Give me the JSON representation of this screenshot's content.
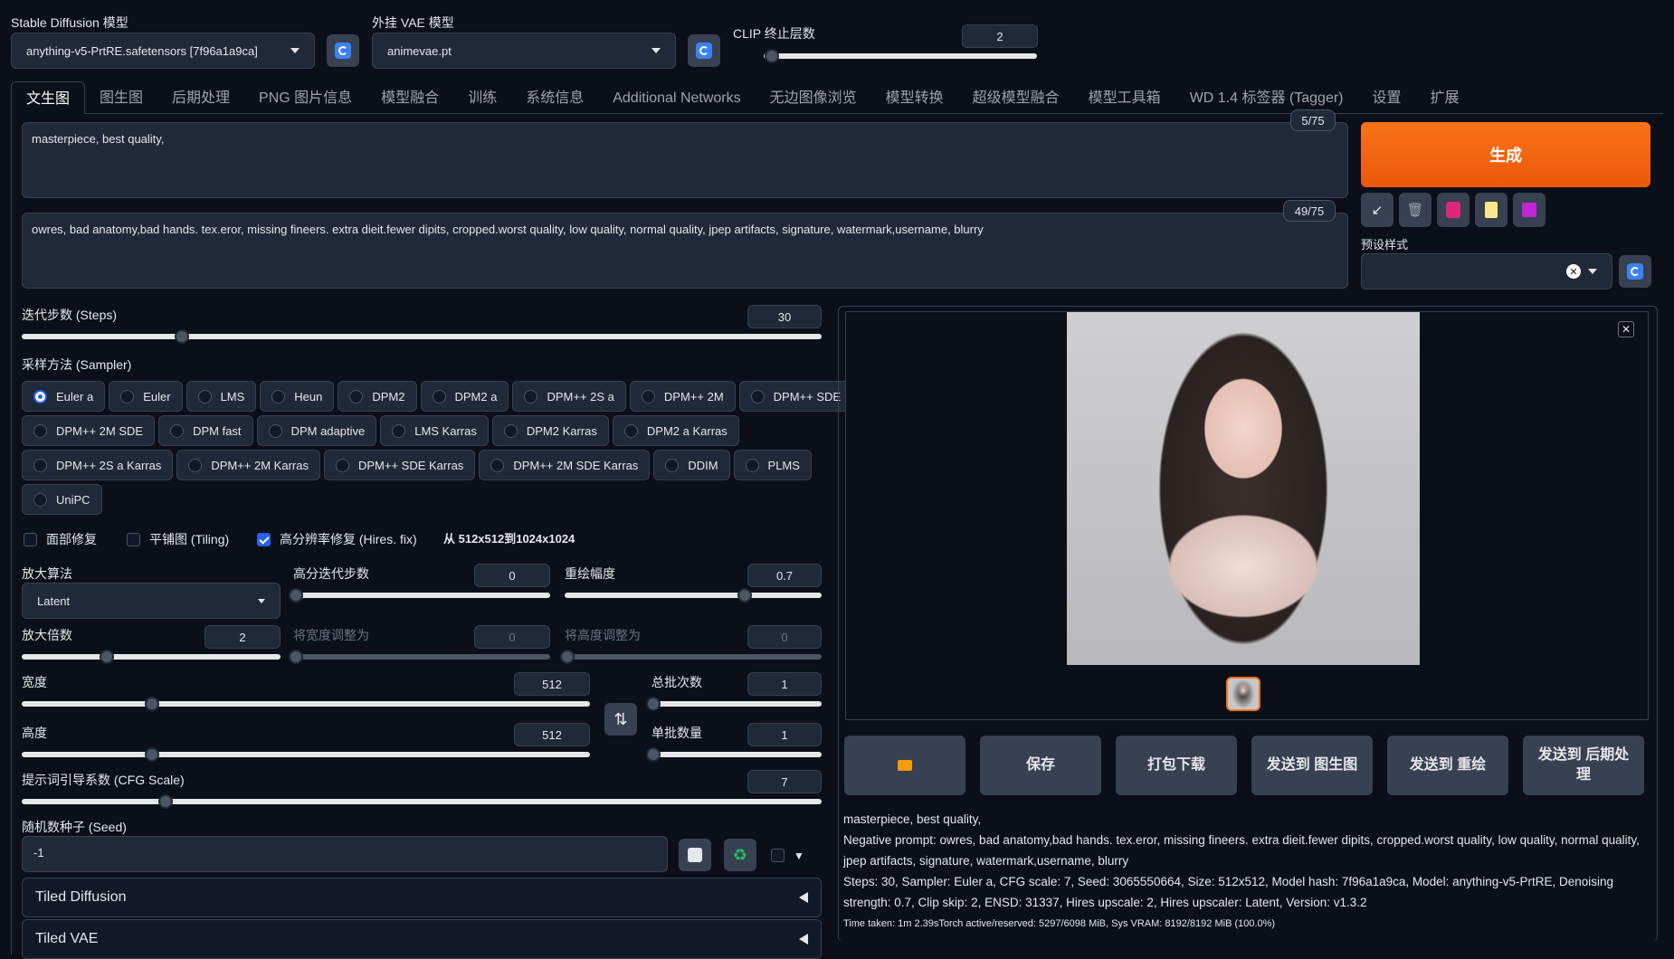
{
  "models": {
    "sd_label": "Stable Diffusion 模型",
    "sd_value": "anything-v5-PrtRE.safetensors [7f96a1a9ca]",
    "vae_label": "外挂 VAE 模型",
    "vae_value": "animevae.pt",
    "clip_label": "CLIP 终止层数",
    "clip_value": "2",
    "clip_fraction": 0.0
  },
  "tabs": [
    "文生图",
    "图生图",
    "后期处理",
    "PNG 图片信息",
    "模型融合",
    "训练",
    "系统信息",
    "Additional Networks",
    "无边图像浏览",
    "模型转换",
    "超级模型融合",
    "模型工具箱",
    "WD 1.4 标签器 (Tagger)",
    "设置",
    "扩展"
  ],
  "prompt": {
    "positive": "masterpiece, best quality,",
    "positive_tokens": "5/75",
    "negative": "owres, bad anatomy,bad hands. tex.eror, missing fineers. extra dieit.fewer dipits, cropped.worst quality, low quality, normal quality, jpep artifacts, signature, watermark,username, blurry",
    "negative_tokens": "49/75"
  },
  "generate": {
    "label": "生成",
    "tool_icons": [
      "arrow-icon",
      "trash-icon",
      "palette-icon",
      "clipboard-icon",
      "save-icon"
    ],
    "style_label": "预设样式"
  },
  "steps": {
    "label": "迭代步数 (Steps)",
    "value": "30",
    "fraction": 0.2
  },
  "sampler": {
    "label": "采样方法 (Sampler)",
    "rows": [
      [
        "Euler a",
        "Euler",
        "LMS",
        "Heun",
        "DPM2",
        "DPM2 a",
        "DPM++ 2S a",
        "DPM++ 2M",
        "DPM++ SDE"
      ],
      [
        "DPM++ 2M SDE",
        "DPM fast",
        "DPM adaptive",
        "LMS Karras",
        "DPM2 Karras",
        "DPM2 a Karras"
      ],
      [
        "DPM++ 2S a Karras",
        "DPM++ 2M Karras",
        "DPM++ SDE Karras",
        "DPM++ 2M SDE Karras",
        "DDIM",
        "PLMS"
      ],
      [
        "UniPC"
      ]
    ],
    "selected": "Euler a"
  },
  "options": {
    "face": "面部修复",
    "tiling": "平铺图 (Tiling)",
    "hires": "高分辨率修复 (Hires. fix)",
    "hires_note": "从 512x512到1024x1024"
  },
  "hires": {
    "upscaler_label": "放大算法",
    "upscaler_value": "Latent",
    "hires_steps_label": "高分迭代步数",
    "hires_steps_value": "0",
    "denoise_label": "重绘幅度",
    "denoise_value": "0.7",
    "scale_label": "放大倍数",
    "scale_value": "2",
    "resize_w_label": "将宽度调整为",
    "resize_w_value": "0",
    "resize_h_label": "将高度调整为",
    "resize_h_value": "0"
  },
  "size": {
    "width_label": "宽度",
    "width_value": "512",
    "height_label": "高度",
    "height_value": "512",
    "batch_count_label": "总批次数",
    "batch_count_value": "1",
    "batch_size_label": "单批数量",
    "batch_size_value": "1"
  },
  "cfg": {
    "label": "提示词引导系数 (CFG Scale)",
    "value": "7"
  },
  "seed": {
    "label": "随机数种子 (Seed)",
    "value": "-1"
  },
  "accordions": [
    "Tiled Diffusion",
    "Tiled VAE"
  ],
  "actions": [
    "📂",
    "保存",
    "打包下载",
    "发送到 图生图",
    "发送到 重绘",
    "发送到 后期处理"
  ],
  "output": {
    "line1": "masterpiece, best quality,",
    "line2": "Negative prompt: owres, bad anatomy,bad hands. tex.eror, missing fineers. extra dieit.fewer dipits, cropped.worst quality, low quality, normal quality, jpep artifacts, signature, watermark,username, blurry",
    "line3": "Steps: 30, Sampler: Euler a, CFG scale: 7, Seed: 3065550664, Size: 512x512, Model hash: 7f96a1a9ca, Model: anything-v5-PrtRE, Denoising strength: 0.7, Clip skip: 2, ENSD: 31337, Hires upscale: 2, Hires upscaler: Latent, Version: v1.3.2",
    "timing": "Time taken: 1m 2.39sTorch active/reserved: 5297/6098 MiB, Sys VRAM: 8192/8192 MiB (100.0%)"
  }
}
